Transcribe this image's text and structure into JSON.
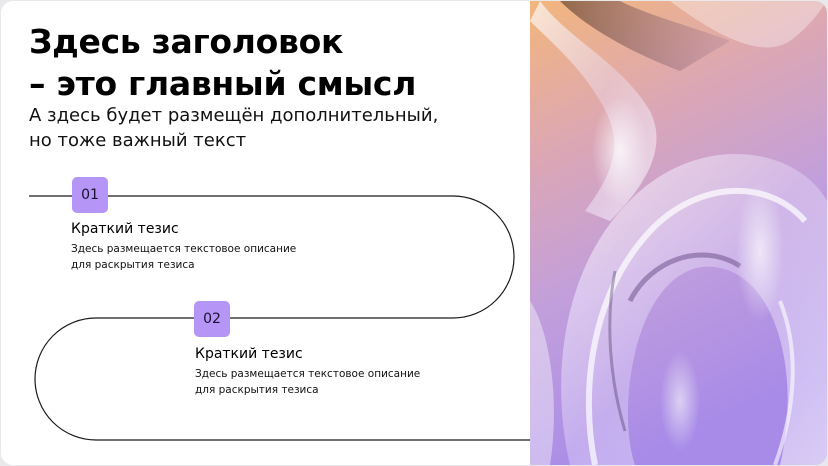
{
  "header": {
    "title_line1": "Здесь заголовок",
    "title_line2": "– это главный смысл",
    "subtitle_line1": "А здесь будет размещён дополнительный,",
    "subtitle_line2": "но тоже важный текст"
  },
  "steps": [
    {
      "number": "01",
      "title": "Краткий тезис",
      "desc_line1": "Здесь размещается текстовое описание",
      "desc_line2": "для раскрытия тезиса"
    },
    {
      "number": "02",
      "title": "Краткий тезис",
      "desc_line1": "Здесь размещается текстовое описание",
      "desc_line2": "для раскрытия тезиса"
    }
  ],
  "colors": {
    "badge_bg": "#b595f5",
    "line": "#1a1a1a",
    "art_top": "#f1b27d",
    "art_mid": "#d7a6c3",
    "art_bottom": "#a98ae6"
  }
}
